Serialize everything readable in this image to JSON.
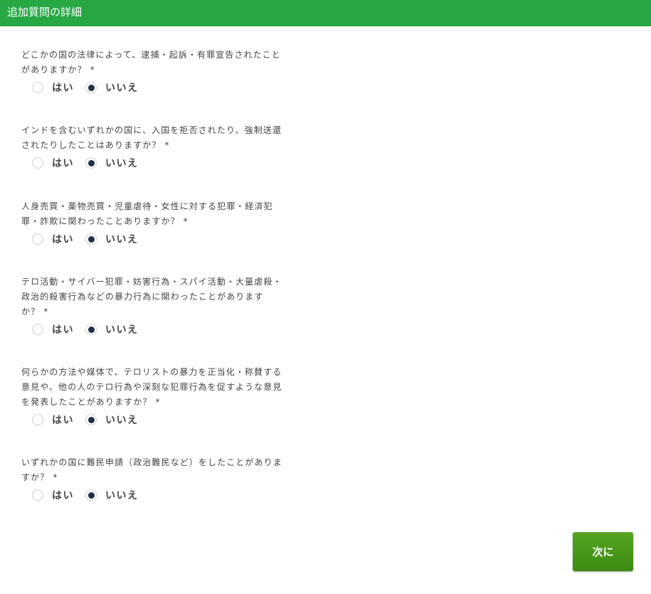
{
  "header": {
    "title": "追加質問の詳細",
    "color": "#28a745"
  },
  "radio_checked_color": "#1f3049",
  "required_mark": "*",
  "questions": [
    {
      "lines": [
        "どこかの国の法律によって、逮捕・起訴・有罪宣告されたこと",
        "がありますか？"
      ],
      "options": {
        "yes": "はい",
        "no": "いいえ"
      },
      "selected": "no"
    },
    {
      "lines": [
        "インドを含むいずれかの国に、入国を拒否されたり、強制送還",
        "されたりしたことはありますか？"
      ],
      "options": {
        "yes": "はい",
        "no": "いいえ"
      },
      "selected": "no"
    },
    {
      "lines": [
        "人身売買・薬物売買・児童虐待・女性に対する犯罪・経済犯",
        "罪・詐欺に関わったことありますか？"
      ],
      "options": {
        "yes": "はい",
        "no": "いいえ"
      },
      "selected": "no"
    },
    {
      "lines": [
        "テロ活動・サイバー犯罪・妨害行為・スパイ活動・大量虐殺・",
        "政治的殺害行為などの暴力行為に関わったことがあります",
        "か？"
      ],
      "options": {
        "yes": "はい",
        "no": "いいえ"
      },
      "selected": "no"
    },
    {
      "lines": [
        "何らかの方法や媒体で、テロリストの暴力を正当化・称賛する",
        "意見や、他の人のテロ行為や深刻な犯罪行為を促すような意見",
        "を発表したことがありますか？"
      ],
      "options": {
        "yes": "はい",
        "no": "いいえ"
      },
      "selected": "no"
    },
    {
      "lines": [
        "いずれかの国に難民申請（政治難民など）をしたことがありま",
        "すか？"
      ],
      "options": {
        "yes": "はい",
        "no": "いいえ"
      },
      "selected": "no"
    }
  ],
  "next_button": {
    "label": "次に",
    "color": "#4a9a1a"
  }
}
